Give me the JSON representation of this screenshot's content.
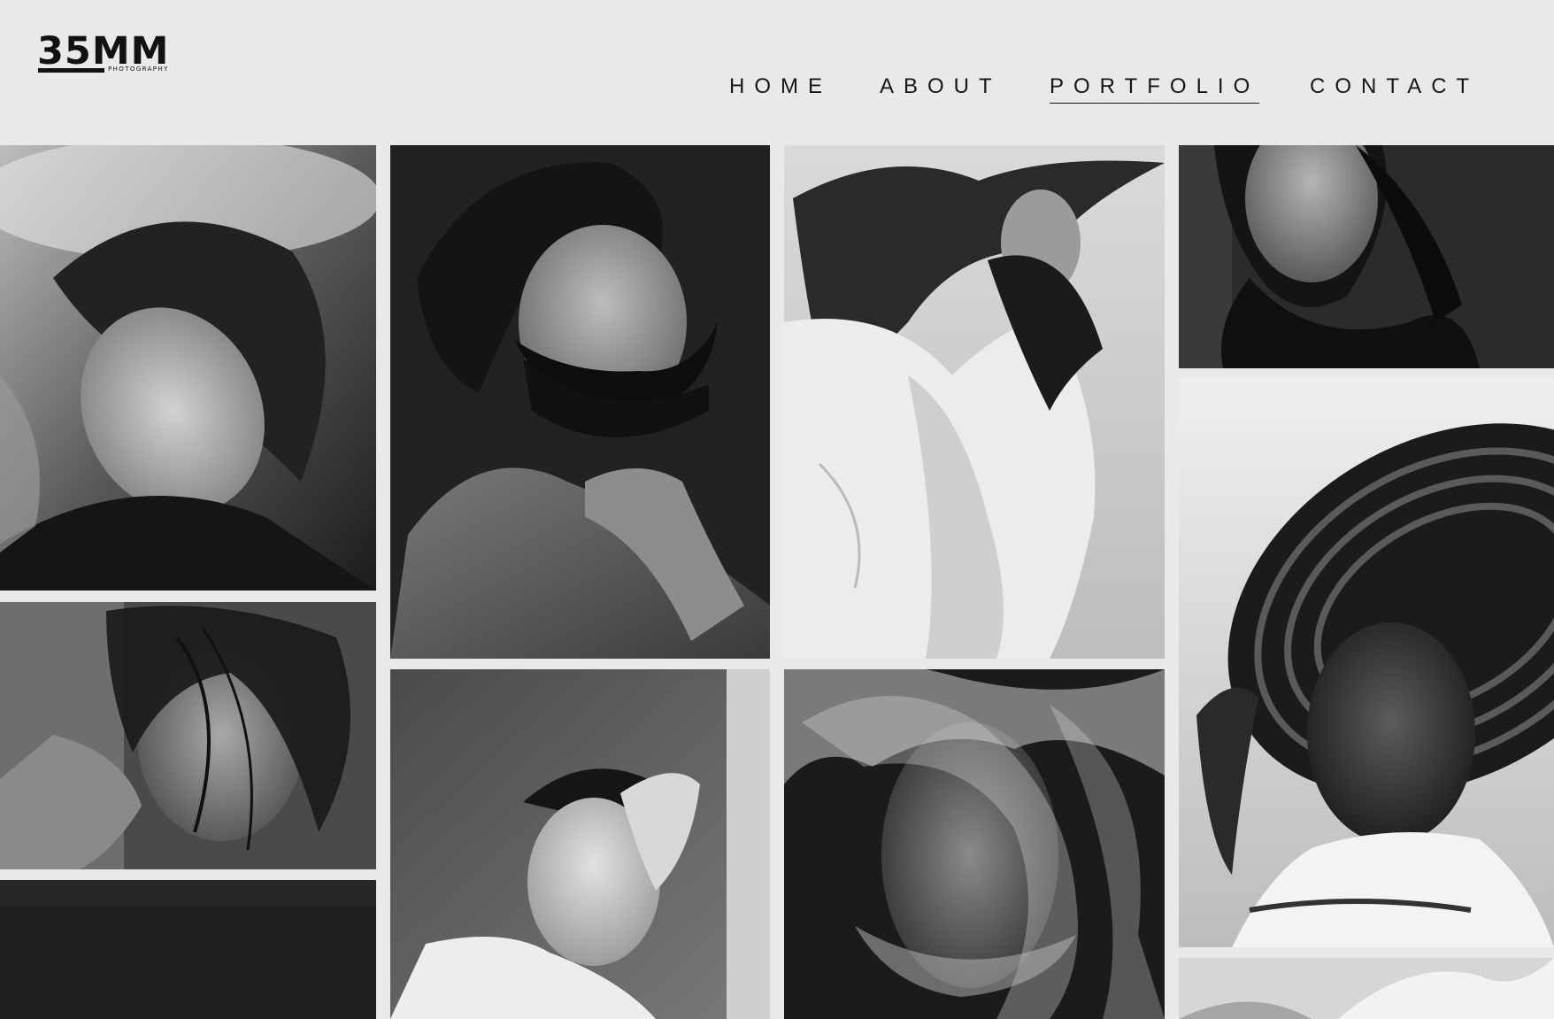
{
  "logo": {
    "main": "35MM",
    "sub": "PHOTOGRAPHY"
  },
  "nav": {
    "items": [
      {
        "label": "HOME",
        "active": false
      },
      {
        "label": "ABOUT",
        "active": false
      },
      {
        "label": "PORTFOLIO",
        "active": true
      },
      {
        "label": "CONTACT",
        "active": false
      }
    ]
  },
  "gallery": {
    "photos": [
      {
        "subject": "woman with curly hair, eyes closed, head tilted back"
      },
      {
        "subject": "bearded man, bare shoulder, hand on shoulder"
      },
      {
        "subject": "woman with windblown hair in white lace jacket"
      },
      {
        "subject": "woman with long dark hair, close-up face"
      },
      {
        "subject": "woman with windswept hair covering face"
      },
      {
        "subject": "woman with hand on forehead, eyes closed"
      },
      {
        "subject": "face wrapped in sheer tulle fabric"
      },
      {
        "subject": "woman in wide striped sun hat"
      },
      {
        "subject": "dark textured photo, partially visible"
      },
      {
        "subject": "light photo, partially visible"
      }
    ]
  },
  "colors": {
    "background": "#e9e9e9",
    "text": "#161616"
  }
}
